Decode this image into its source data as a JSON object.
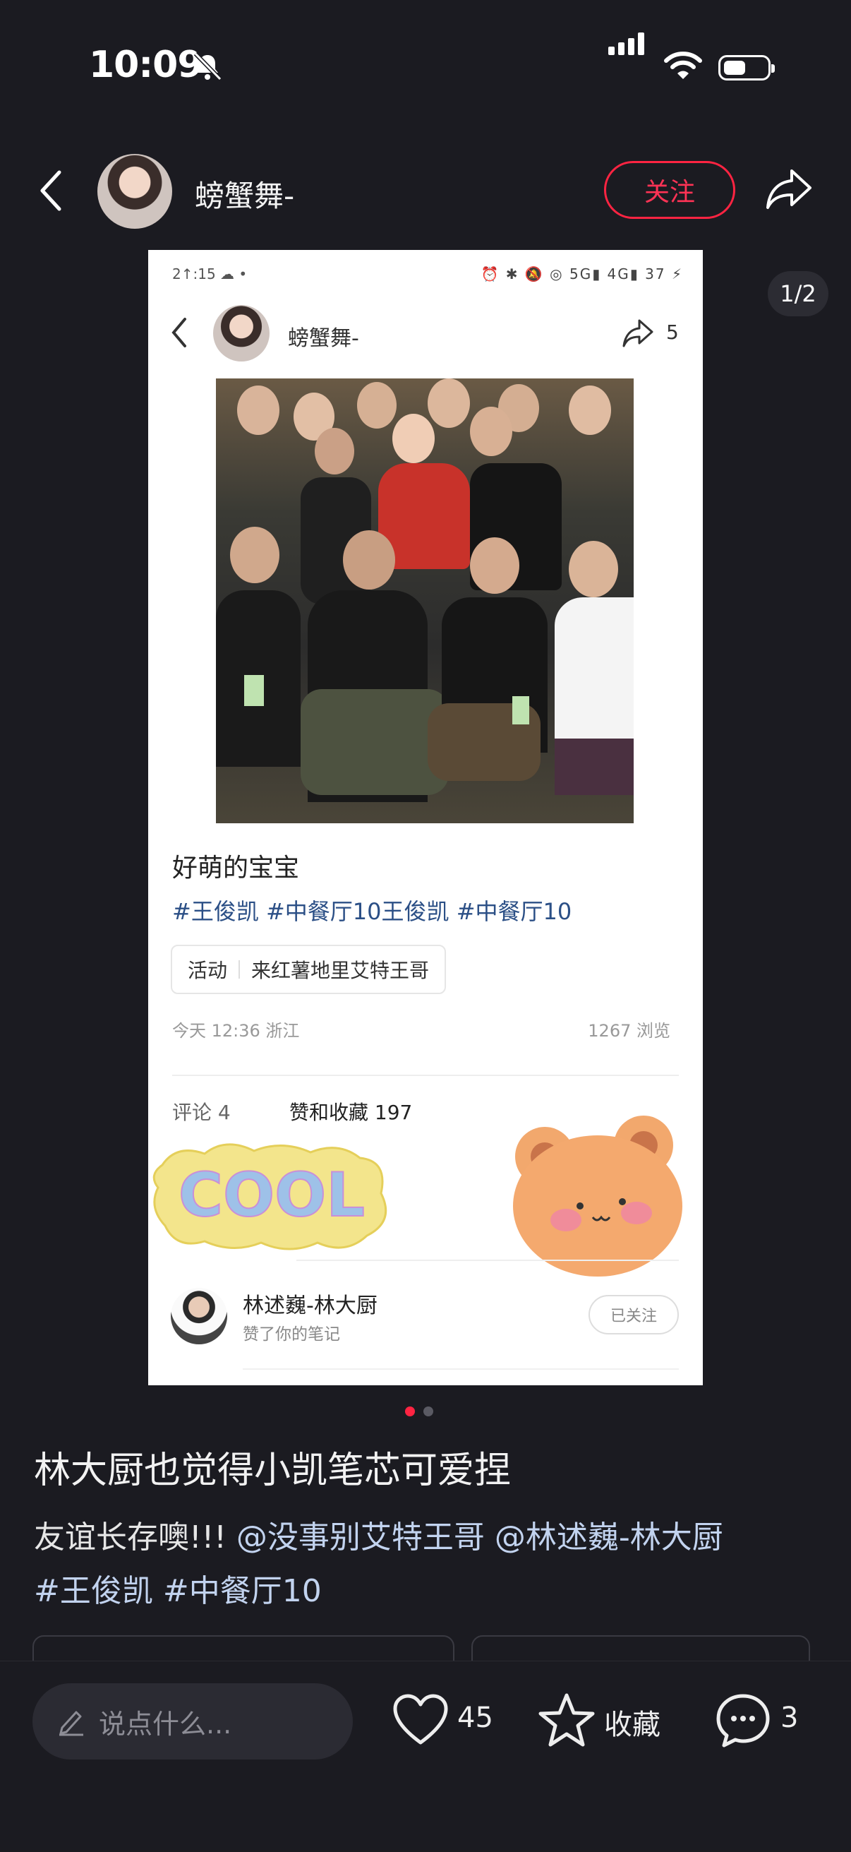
{
  "status_bar": {
    "time": "10:09"
  },
  "header": {
    "author_name": "螃蟹舞-",
    "follow_label": "关注"
  },
  "page_indicator": "1/2",
  "card": {
    "inner_status_left": "2↑:15 ☁ •",
    "inner_status_right": "⏰ ✱ 🔕 ◎ 5G▮ 4G▮ 37 ⚡",
    "author_name": "螃蟹舞-",
    "share_count": "5",
    "title": "好萌的宝宝",
    "tags": "#王俊凯 #中餐厅10王俊凯 #中餐厅10",
    "activity_label": "活动",
    "activity_text": "来红薯地里艾特王哥",
    "meta": "今天 12:36 浙江",
    "views": "1267 浏览",
    "comments": "评论 4",
    "likes_collects": "赞和收藏 197",
    "sticker_text": "COOL",
    "notification": {
      "name": "林述巍-林大厨",
      "subtitle": "赞了你的笔记",
      "button": "已关注"
    }
  },
  "note": {
    "title": "林大厨也觉得小凯笔芯可爱捏",
    "body_prefix": "友谊长存噢!!! ",
    "mention1": "@没事别艾特王哥",
    "mention2": "@林述巍-林大厨",
    "hashtags": "#王俊凯 #中餐厅10"
  },
  "bottom_bar": {
    "input_placeholder": "说点什么...",
    "like_count": "45",
    "collect_label": "收藏",
    "comment_count": "3"
  },
  "colors": {
    "accent": "#ff2442",
    "background": "#1b1b21",
    "link": "#2b4f86"
  }
}
